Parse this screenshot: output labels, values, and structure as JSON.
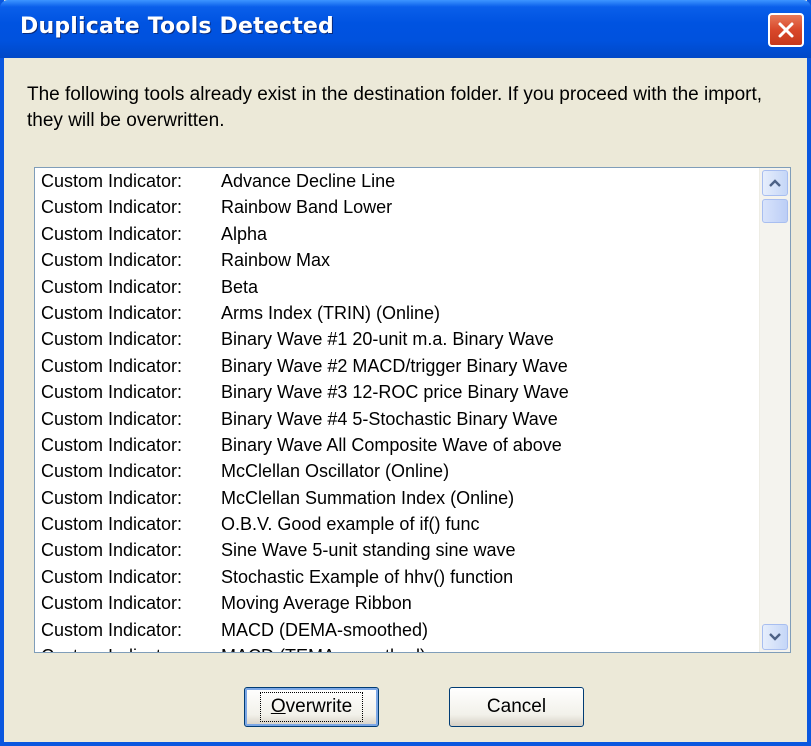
{
  "window": {
    "title": "Duplicate Tools Detected",
    "close_icon": "close-icon",
    "colors": {
      "titlebar": "#0052DE",
      "close": "#D9482A",
      "face": "#ECE9D8"
    }
  },
  "message": "The following tools already exist in the destination folder.  If you proceed with the import, they will be overwritten.",
  "list": {
    "items": [
      {
        "prefix": "Custom Indicator:",
        "name": "Advance Decline Line"
      },
      {
        "prefix": "Custom Indicator:",
        "name": "Rainbow Band Lower"
      },
      {
        "prefix": "Custom Indicator:",
        "name": "Alpha"
      },
      {
        "prefix": "Custom Indicator:",
        "name": "Rainbow Max"
      },
      {
        "prefix": "Custom Indicator:",
        "name": "Beta"
      },
      {
        "prefix": "Custom Indicator:",
        "name": "Arms Index (TRIN) (Online)"
      },
      {
        "prefix": "Custom Indicator:",
        "name": "Binary Wave #1 20-unit m.a. Binary Wave"
      },
      {
        "prefix": "Custom Indicator:",
        "name": "Binary Wave #2  MACD/trigger Binary Wave"
      },
      {
        "prefix": "Custom Indicator:",
        "name": "Binary Wave #3 12-ROC price Binary Wave"
      },
      {
        "prefix": "Custom Indicator:",
        "name": "Binary Wave #4  5-Stochastic Binary Wave"
      },
      {
        "prefix": "Custom Indicator:",
        "name": "Binary Wave All  Composite Wave of above"
      },
      {
        "prefix": "Custom Indicator:",
        "name": "McClellan Oscillator (Online)"
      },
      {
        "prefix": "Custom Indicator:",
        "name": "McClellan Summation Index (Online)"
      },
      {
        "prefix": "Custom Indicator:",
        "name": "O.B.V. Good example of if() func"
      },
      {
        "prefix": "Custom Indicator:",
        "name": "Sine Wave 5-unit standing sine wave"
      },
      {
        "prefix": "Custom Indicator:",
        "name": "Stochastic Example of hhv() function"
      },
      {
        "prefix": "Custom Indicator:",
        "name": "Moving Average Ribbon"
      },
      {
        "prefix": "Custom Indicator:",
        "name": "MACD (DEMA-smoothed)"
      },
      {
        "prefix": "Custom Indicator:",
        "name": "MACD (TEMA-smoothed)"
      }
    ],
    "scroll_up_icon": "chevron-up-icon",
    "scroll_down_icon": "chevron-down-icon"
  },
  "buttons": {
    "overwrite_mnemonic": "O",
    "overwrite_rest": "verwrite",
    "cancel": "Cancel"
  }
}
